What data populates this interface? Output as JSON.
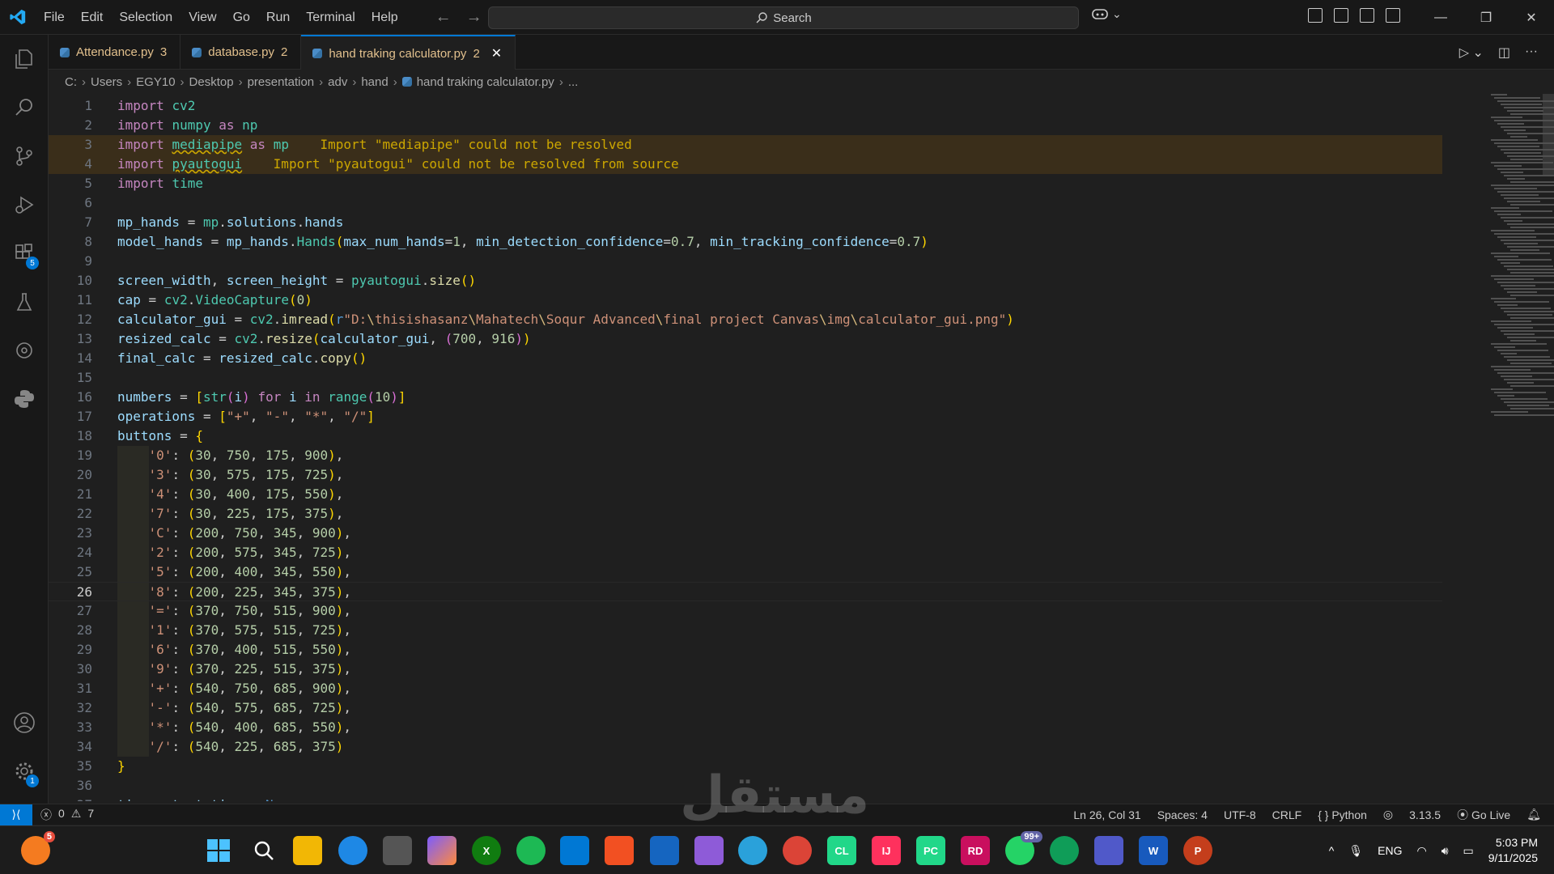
{
  "menu": [
    "File",
    "Edit",
    "Selection",
    "View",
    "Go",
    "Run",
    "Terminal",
    "Help"
  ],
  "search_label": "Search",
  "tabs": [
    {
      "name": "Attendance.py",
      "count": "3"
    },
    {
      "name": "database.py",
      "count": "2"
    },
    {
      "name": "hand traking calculator.py",
      "count": "2"
    }
  ],
  "breadcrumb": [
    "C:",
    "Users",
    "EGY10",
    "Desktop",
    "presentation",
    "adv",
    "hand",
    "hand traking calculator.py",
    "..."
  ],
  "code_lines": [
    "import cv2",
    "import numpy as np",
    "import mediapipe as mp",
    "import pyautogui",
    "import time",
    "",
    "mp_hands = mp.solutions.hands",
    "model_hands = mp_hands.Hands(max_num_hands=1, min_detection_confidence=0.7, min_tracking_confidence=0.7)",
    "",
    "screen_width, screen_height = pyautogui.size()",
    "cap = cv2.VideoCapture(0)",
    "calculator_gui = cv2.imread(r\"D:\\thisishasanz\\Mahatech\\Soqur Advanced\\final project Canvas\\img\\calculator_gui.png\")",
    "resized_calc = cv2.resize(calculator_gui, (700, 916))",
    "final_calc = resized_calc.copy()",
    "",
    "numbers = [str(i) for i in range(10)]",
    "operations = [\"+\", \"-\", \"*\", \"/\"]",
    "buttons = {",
    "    '0': (30, 750, 175, 900),",
    "    '3': (30, 575, 175, 725),",
    "    '4': (30, 400, 175, 550),",
    "    '7': (30, 225, 175, 375),",
    "    'C': (200, 750, 345, 900),",
    "    '2': (200, 575, 345, 725),",
    "    '5': (200, 400, 345, 550),",
    "    '8': (200, 225, 345, 375),",
    "    '=': (370, 750, 515, 900),",
    "    '1': (370, 575, 515, 725),",
    "    '6': (370, 400, 515, 550),",
    "    '9': (370, 225, 515, 375),",
    "    '+': (540, 750, 685, 900),",
    "    '-': (540, 575, 685, 725),",
    "    '*': (540, 400, 685, 550),",
    "    '/': (540, 225, 685, 375)",
    "}",
    "",
    "timer_start_time = None"
  ],
  "warnings": {
    "line3": "Import \"mediapipe\" could not be resolved",
    "line4": "Import \"pyautogui\" could not be resolved from source"
  },
  "current_line": 26,
  "activity_badges": {
    "extensions": "5",
    "settings": "1"
  },
  "status": {
    "errors": "0",
    "warnings": "7",
    "position": "Ln 26, Col 31",
    "spaces": "Spaces: 4",
    "encoding": "UTF-8",
    "eol": "CRLF",
    "language": "Python",
    "version": "3.13.5",
    "golive": "Go Live"
  },
  "taskbar": {
    "notif_badge": "5",
    "whatsapp_badge": "99+",
    "lang": "ENG",
    "time": "5:03 PM",
    "date": "9/11/2025"
  },
  "watermark": "مستقل",
  "colors": {
    "accent": "#0078d4",
    "warning": "#cca700",
    "editor_bg": "#1f1f1f"
  }
}
